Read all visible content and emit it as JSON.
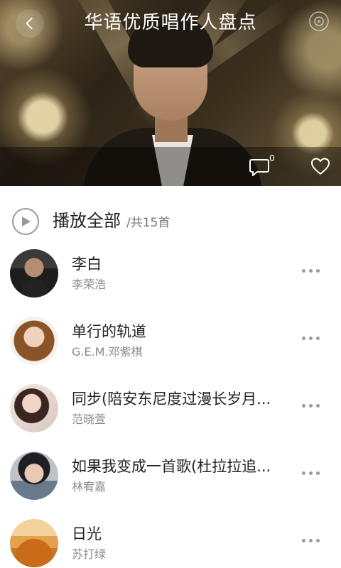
{
  "header": {
    "title": "华语优质唱作人盘点",
    "back_icon": "chevron-left-icon",
    "disc_icon": "disc-icon",
    "comment_count": "0",
    "comment_icon": "comment-icon",
    "like_icon": "heart-icon"
  },
  "play_all": {
    "label": "播放全部",
    "count": "/共15首",
    "icon": "play-circle-icon"
  },
  "songs": [
    {
      "title": "李白",
      "artist": "李荣浩"
    },
    {
      "title": "单行的轨道",
      "artist": "G.E.M.邓紫棋"
    },
    {
      "title": "同步(陪安东尼度过漫长岁月...",
      "artist": "范晓萱"
    },
    {
      "title": "如果我变成一首歌(杜拉拉追...",
      "artist": "林宥嘉"
    },
    {
      "title": "日光",
      "artist": "苏打绿"
    }
  ],
  "colors": {
    "text_primary": "#222222",
    "text_secondary": "#8a8a8a",
    "icon_gray": "#9b9b9b"
  }
}
